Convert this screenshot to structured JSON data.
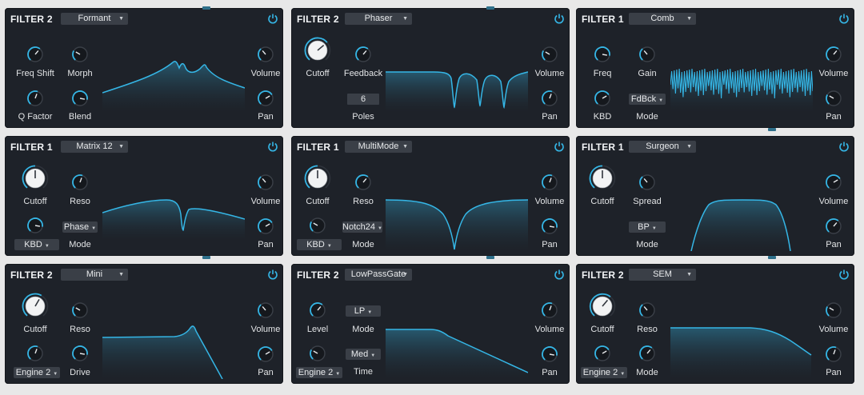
{
  "panels": [
    {
      "title": "FILTER 2",
      "type": "Formant",
      "labels": {
        "k1": "Freq Shift",
        "k2": "Morph",
        "k3": "Q Factor",
        "k4": "Blend",
        "vol": "Volume",
        "pan": "Pan"
      }
    },
    {
      "title": "FILTER 2",
      "type": "Phaser",
      "labels": {
        "k1": "Cutoff",
        "k2": "Feedback",
        "k4": "Poles",
        "vol": "Volume",
        "pan": "Pan"
      },
      "poles_value": "6"
    },
    {
      "title": "FILTER 1",
      "type": "Comb",
      "labels": {
        "k1": "Freq",
        "k2": "Gain",
        "k3": "KBD",
        "k4": "Mode",
        "vol": "Volume",
        "pan": "Pan"
      },
      "mode_value": "FdBck"
    },
    {
      "title": "FILTER 1",
      "type": "Matrix 12",
      "labels": {
        "k1": "Cutoff",
        "k2": "Reso",
        "k4": "Mode",
        "vol": "Volume",
        "pan": "Pan"
      },
      "mode_value": "Phase",
      "kbd_value": "KBD"
    },
    {
      "title": "FILTER 1",
      "type": "MultiMode",
      "labels": {
        "k1": "Cutoff",
        "k2": "Reso",
        "k4": "Mode",
        "vol": "Volume",
        "pan": "Pan"
      },
      "mode_value": "Notch24",
      "kbd_value": "KBD"
    },
    {
      "title": "FILTER 1",
      "type": "Surgeon",
      "labels": {
        "k1": "Cutoff",
        "k2": "Spread",
        "k4": "Mode",
        "vol": "Volume",
        "pan": "Pan"
      },
      "mode_value": "BP"
    },
    {
      "title": "FILTER 2",
      "type": "Mini",
      "labels": {
        "k1": "Cutoff",
        "k2": "Reso",
        "k4": "Drive",
        "vol": "Volume",
        "pan": "Pan"
      },
      "engine_value": "Engine 2"
    },
    {
      "title": "FILTER 2",
      "type": "LowPassGate",
      "labels": {
        "k1": "Level",
        "k2": "Mode",
        "k4": "Time",
        "vol": "Volume",
        "pan": "Pan"
      },
      "mode_value": "LP",
      "time_value": "Med",
      "engine_value": "Engine 2"
    },
    {
      "title": "FILTER 2",
      "type": "SEM",
      "labels": {
        "k1": "Cutoff",
        "k2": "Reso",
        "k4": "Mode",
        "vol": "Volume",
        "pan": "Pan"
      },
      "engine_value": "Engine 2"
    }
  ],
  "colors": {
    "accent": "#35b6e6",
    "panel_bg": "#1e2229",
    "dropdown_bg": "#3a3f47"
  }
}
